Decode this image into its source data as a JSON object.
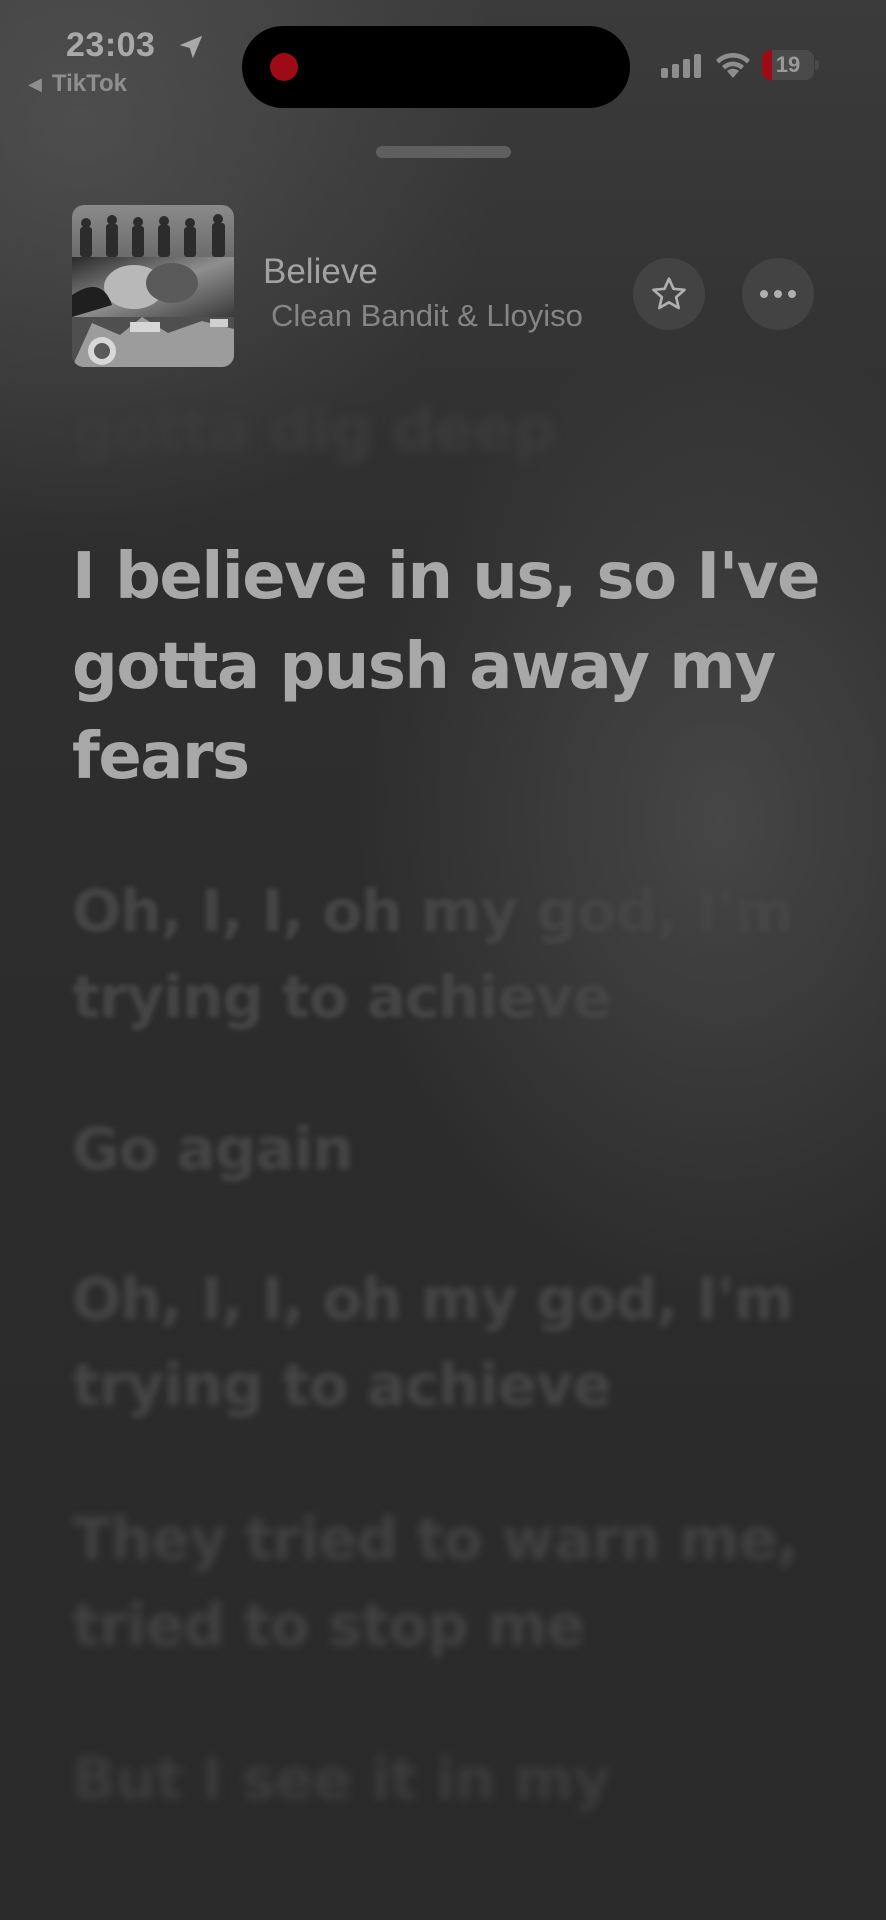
{
  "status_bar": {
    "time": "23:03",
    "back_app": "TikTok",
    "battery_level": "19",
    "battery_fraction": 0.19
  },
  "now_playing": {
    "title": "Believe",
    "artist": "Clean Bandit & Lloyiso",
    "favorite_icon": "star-icon",
    "more_icon": "ellipsis-icon"
  },
  "lyrics": {
    "previous": "gotta dig deep",
    "current": "I believe in us, so I've gotta push away my fears",
    "upcoming": [
      "Oh, I, I, oh my god, I'm trying to achieve",
      "Go again",
      "Oh, I, I, oh my god, I'm trying to achieve",
      "They tried to warn me, tried to stop me",
      "But I see it in my"
    ]
  },
  "colors": {
    "recording_indicator": "#9e0b16",
    "battery_low": "#9e0b16"
  }
}
